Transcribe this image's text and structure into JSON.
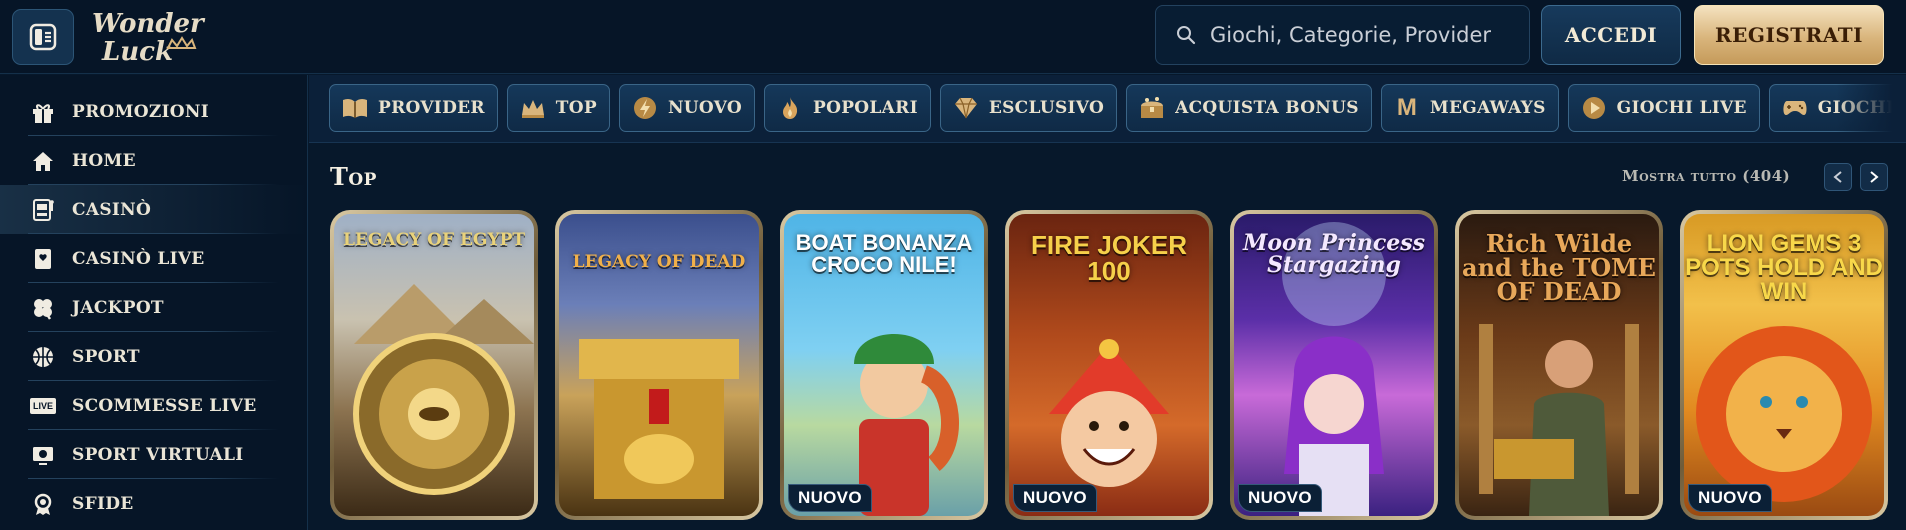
{
  "header": {
    "menu_icon": "menu-panel-icon",
    "logo_line1": "Wonder",
    "logo_line2": "Luck",
    "search_placeholder": "Giochi, Categorie, Provider",
    "login_label": "ACCEDI",
    "register_label": "REGISTRATI"
  },
  "sidebar": {
    "items": [
      {
        "label": "PROMOZIONI",
        "icon": "gift-icon"
      },
      {
        "label": "HOME",
        "icon": "home-icon"
      },
      {
        "label": "CASINÒ",
        "icon": "slot-machine-icon",
        "active": true
      },
      {
        "label": "CASINÒ LIVE",
        "icon": "playing-card-icon"
      },
      {
        "label": "JACKPOT",
        "icon": "clover-icon"
      },
      {
        "label": "SPORT",
        "icon": "basketball-icon"
      },
      {
        "label": "SCOMMESSE LIVE",
        "icon": "live-icon",
        "icon_text": "LIVE"
      },
      {
        "label": "SPORT VIRTUALI",
        "icon": "virtual-sport-icon"
      },
      {
        "label": "SFIDE",
        "icon": "medal-icon"
      }
    ]
  },
  "categories": [
    {
      "label": "PROVIDER",
      "icon": "book-icon"
    },
    {
      "label": "TOP",
      "icon": "crown-icon"
    },
    {
      "label": "NUOVO",
      "icon": "lightning-icon"
    },
    {
      "label": "POPOLARI",
      "icon": "fire-icon"
    },
    {
      "label": "ESCLUSIVO",
      "icon": "diamond-icon"
    },
    {
      "label": "ACQUISTA BONUS",
      "icon": "treasure-chest-icon"
    },
    {
      "label": "MEGAWAYS",
      "icon": "megaways-icon",
      "icon_text": "M"
    },
    {
      "label": "GIOCHI LIVE",
      "icon": "play-icon"
    },
    {
      "label": "GIOCHI ISTANTANEI",
      "icon": "gamepad-icon"
    }
  ],
  "section": {
    "title": "Top",
    "show_all_label": "Mostra tutto (404)"
  },
  "games": [
    {
      "title": "LEGACY OF EGYPT",
      "badge": ""
    },
    {
      "title": "LEGACY OF DEAD",
      "badge": ""
    },
    {
      "title": "BOAT BONANZA CROCO NILE!",
      "badge": "NUOVO"
    },
    {
      "title": "FIRE JOKER 100",
      "badge": "NUOVO"
    },
    {
      "title": "Moon Princess Stargazing",
      "badge": "NUOVO"
    },
    {
      "title": "Rich Wilde and the TOME OF DEAD",
      "badge": ""
    },
    {
      "title": "LION GEMS 3 POTS HOLD AND WIN",
      "badge": "NUOVO"
    }
  ],
  "colors": {
    "background": "#07182b",
    "accent_gold": "#d9b57c",
    "badge_bg": "#0b2036"
  }
}
